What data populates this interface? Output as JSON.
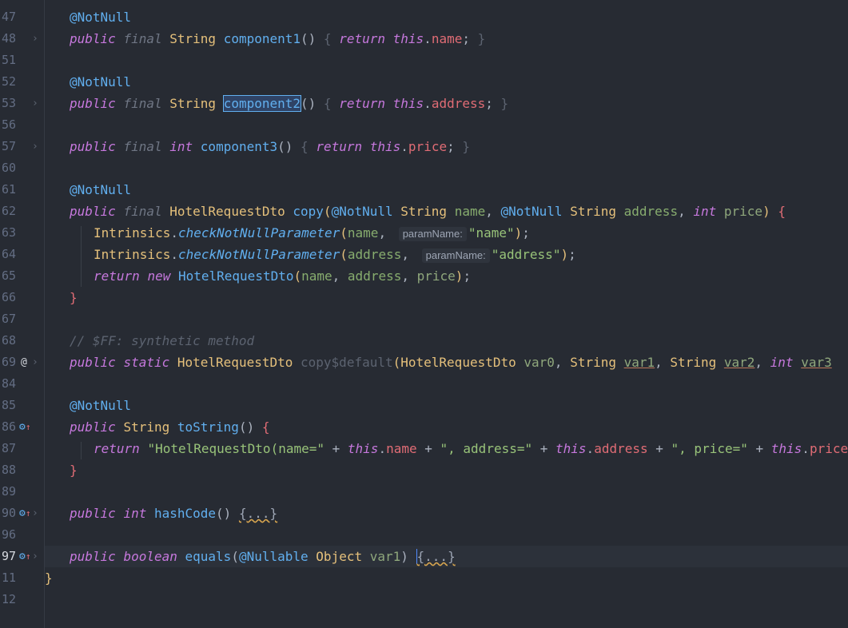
{
  "editor": {
    "lines": [
      {
        "num": "47",
        "tokens": [
          [
            "ann",
            "@NotNull"
          ]
        ]
      },
      {
        "num": "48",
        "tokens": [
          [
            "kw",
            "public"
          ],
          [
            "punc",
            " "
          ],
          [
            "kw-dim",
            "final"
          ],
          [
            "punc",
            " "
          ],
          [
            "type",
            "String"
          ],
          [
            "punc",
            " "
          ],
          [
            "fn",
            "component1"
          ],
          [
            "punc",
            "() "
          ],
          [
            "brace-dim",
            "{"
          ],
          [
            "punc",
            " "
          ],
          [
            "kw",
            "return"
          ],
          [
            "punc",
            " "
          ],
          [
            "kw",
            "this"
          ],
          [
            "punc",
            "."
          ],
          [
            "field",
            "name"
          ],
          [
            "punc",
            "; "
          ],
          [
            "brace-dim",
            "}"
          ]
        ]
      },
      {
        "num": "51",
        "tokens": []
      },
      {
        "num": "52",
        "tokens": [
          [
            "ann",
            "@NotNull"
          ]
        ]
      },
      {
        "num": "53",
        "tokens": [
          [
            "kw",
            "public"
          ],
          [
            "punc",
            " "
          ],
          [
            "kw-dim",
            "final"
          ],
          [
            "punc",
            " "
          ],
          [
            "type",
            "String"
          ],
          [
            "punc",
            " "
          ],
          [
            "sel",
            "component2"
          ],
          [
            "punc",
            "() "
          ],
          [
            "brace-dim",
            "{"
          ],
          [
            "punc",
            " "
          ],
          [
            "kw",
            "return"
          ],
          [
            "punc",
            " "
          ],
          [
            "kw",
            "this"
          ],
          [
            "punc",
            "."
          ],
          [
            "field",
            "address"
          ],
          [
            "punc",
            "; "
          ],
          [
            "brace-dim",
            "}"
          ]
        ]
      },
      {
        "num": "56",
        "tokens": []
      },
      {
        "num": "57",
        "tokens": [
          [
            "kw",
            "public"
          ],
          [
            "punc",
            " "
          ],
          [
            "kw-dim",
            "final"
          ],
          [
            "punc",
            " "
          ],
          [
            "kw",
            "int"
          ],
          [
            "punc",
            " "
          ],
          [
            "fn",
            "component3"
          ],
          [
            "punc",
            "() "
          ],
          [
            "brace-dim",
            "{"
          ],
          [
            "punc",
            " "
          ],
          [
            "kw",
            "return"
          ],
          [
            "punc",
            " "
          ],
          [
            "kw",
            "this"
          ],
          [
            "punc",
            "."
          ],
          [
            "field",
            "price"
          ],
          [
            "punc",
            "; "
          ],
          [
            "brace-dim",
            "}"
          ]
        ]
      },
      {
        "num": "60",
        "tokens": []
      },
      {
        "num": "61",
        "tokens": [
          [
            "ann",
            "@NotNull"
          ]
        ]
      },
      {
        "num": "62",
        "tokens": [
          [
            "kw",
            "public"
          ],
          [
            "punc",
            " "
          ],
          [
            "kw-dim",
            "final"
          ],
          [
            "punc",
            " "
          ],
          [
            "type",
            "HotelRequestDto"
          ],
          [
            "punc",
            " "
          ],
          [
            "fn",
            "copy"
          ],
          [
            "yellow",
            "("
          ],
          [
            "ann",
            "@NotNull"
          ],
          [
            "punc",
            " "
          ],
          [
            "type",
            "String"
          ],
          [
            "punc",
            " "
          ],
          [
            "param",
            "name"
          ],
          [
            "punc",
            ", "
          ],
          [
            "ann",
            "@NotNull"
          ],
          [
            "punc",
            " "
          ],
          [
            "type",
            "String"
          ],
          [
            "punc",
            " "
          ],
          [
            "param",
            "address"
          ],
          [
            "punc",
            ", "
          ],
          [
            "kw",
            "int"
          ],
          [
            "punc",
            " "
          ],
          [
            "param-dim",
            "price"
          ],
          [
            "yellow",
            ")"
          ],
          [
            "punc",
            " "
          ],
          [
            "red",
            "{"
          ]
        ]
      },
      {
        "num": "63",
        "indent": 2,
        "tokens": [
          [
            "type",
            "Intrinsics"
          ],
          [
            "punc",
            "."
          ],
          [
            "method-it",
            "checkNotNullParameter"
          ],
          [
            "yellow",
            "("
          ],
          [
            "param",
            "name"
          ],
          [
            "punc",
            ", "
          ],
          [
            "hint",
            "paramName:"
          ],
          [
            "str",
            "\"name\""
          ],
          [
            "yellow",
            ")"
          ],
          [
            "punc",
            ";"
          ]
        ]
      },
      {
        "num": "64",
        "indent": 2,
        "tokens": [
          [
            "type",
            "Intrinsics"
          ],
          [
            "punc",
            "."
          ],
          [
            "method-it",
            "checkNotNullParameter"
          ],
          [
            "yellow",
            "("
          ],
          [
            "param",
            "address"
          ],
          [
            "punc",
            ", "
          ],
          [
            "hint",
            "paramName:"
          ],
          [
            "str",
            "\"address\""
          ],
          [
            "yellow",
            ")"
          ],
          [
            "punc",
            ";"
          ]
        ]
      },
      {
        "num": "65",
        "indent": 2,
        "tokens": [
          [
            "kw",
            "return"
          ],
          [
            "punc",
            " "
          ],
          [
            "kw",
            "new"
          ],
          [
            "punc",
            " "
          ],
          [
            "fn",
            "HotelRequestDto"
          ],
          [
            "yellow",
            "("
          ],
          [
            "param",
            "name"
          ],
          [
            "punc",
            ", "
          ],
          [
            "param",
            "address"
          ],
          [
            "punc",
            ", "
          ],
          [
            "param-dim",
            "price"
          ],
          [
            "yellow",
            ")"
          ],
          [
            "punc",
            ";"
          ]
        ]
      },
      {
        "num": "66",
        "tokens": [
          [
            "red",
            "}"
          ]
        ]
      },
      {
        "num": "67",
        "tokens": []
      },
      {
        "num": "68",
        "tokens": [
          [
            "cmt",
            "// $FF: synthetic method"
          ]
        ]
      },
      {
        "num": "69",
        "icon": "at",
        "tokens": [
          [
            "kw",
            "public"
          ],
          [
            "punc",
            " "
          ],
          [
            "kw",
            "static"
          ],
          [
            "punc",
            " "
          ],
          [
            "type",
            "HotelRequestDto"
          ],
          [
            "punc",
            " "
          ],
          [
            "brace-dim",
            "copy$default"
          ],
          [
            "yellow",
            "("
          ],
          [
            "type",
            "HotelRequestDto"
          ],
          [
            "punc",
            " "
          ],
          [
            "param-dim",
            "var0"
          ],
          [
            "punc",
            ", "
          ],
          [
            "type",
            "String"
          ],
          [
            "punc",
            " "
          ],
          [
            "under",
            "var1"
          ],
          [
            "punc",
            ", "
          ],
          [
            "type",
            "String"
          ],
          [
            "punc",
            " "
          ],
          [
            "under",
            "var2"
          ],
          [
            "punc",
            ", "
          ],
          [
            "kw",
            "int"
          ],
          [
            "punc",
            " "
          ],
          [
            "under",
            "var3"
          ]
        ]
      },
      {
        "num": "84",
        "tokens": []
      },
      {
        "num": "85",
        "tokens": [
          [
            "ann",
            "@NotNull"
          ]
        ]
      },
      {
        "num": "86",
        "icon": "override",
        "tokens": [
          [
            "kw",
            "public"
          ],
          [
            "punc",
            " "
          ],
          [
            "type",
            "String"
          ],
          [
            "punc",
            " "
          ],
          [
            "fn",
            "toString"
          ],
          [
            "punc",
            "() "
          ],
          [
            "red",
            "{"
          ]
        ]
      },
      {
        "num": "87",
        "indent": 2,
        "tokens": [
          [
            "kw",
            "return"
          ],
          [
            "punc",
            " "
          ],
          [
            "str",
            "\"HotelRequestDto(name=\""
          ],
          [
            "punc",
            " + "
          ],
          [
            "kw",
            "this"
          ],
          [
            "punc",
            "."
          ],
          [
            "field",
            "name"
          ],
          [
            "punc",
            " + "
          ],
          [
            "str",
            "\", address=\""
          ],
          [
            "punc",
            " + "
          ],
          [
            "kw",
            "this"
          ],
          [
            "punc",
            "."
          ],
          [
            "field",
            "address"
          ],
          [
            "punc",
            " + "
          ],
          [
            "str",
            "\", price=\""
          ],
          [
            "punc",
            " + "
          ],
          [
            "kw",
            "this"
          ],
          [
            "punc",
            "."
          ],
          [
            "field",
            "price"
          ]
        ]
      },
      {
        "num": "88",
        "tokens": [
          [
            "red",
            "}"
          ]
        ]
      },
      {
        "num": "89",
        "tokens": []
      },
      {
        "num": "90",
        "icon": "override",
        "fold": true,
        "tokens": [
          [
            "kw",
            "public"
          ],
          [
            "punc",
            " "
          ],
          [
            "kw",
            "int"
          ],
          [
            "punc",
            " "
          ],
          [
            "fn",
            "hashCode"
          ],
          [
            "punc",
            "() "
          ],
          [
            "folded",
            "{...}"
          ]
        ]
      },
      {
        "num": "96",
        "tokens": []
      },
      {
        "num": "97",
        "icon": "override",
        "fold": true,
        "active": true,
        "tokens": [
          [
            "kw",
            "public"
          ],
          [
            "punc",
            " "
          ],
          [
            "kw",
            "boolean"
          ],
          [
            "punc",
            " "
          ],
          [
            "fn",
            "equals"
          ],
          [
            "punc",
            "("
          ],
          [
            "ann",
            "@Nullable"
          ],
          [
            "punc",
            " "
          ],
          [
            "type",
            "Object"
          ],
          [
            "punc",
            " "
          ],
          [
            "param-dim",
            "var1"
          ],
          [
            "punc",
            ") "
          ],
          [
            "caretfold",
            "{...}"
          ]
        ]
      },
      {
        "num": "11",
        "indent": 0,
        "tokens": [
          [
            "yellow",
            "}"
          ]
        ]
      },
      {
        "num": "12",
        "indent": 0,
        "tokens": []
      }
    ]
  },
  "colors": {
    "background": "#272b33",
    "keyword": "#c678dd",
    "type": "#e5c07b",
    "function": "#61afef",
    "field": "#e06c75",
    "string": "#98c379"
  }
}
